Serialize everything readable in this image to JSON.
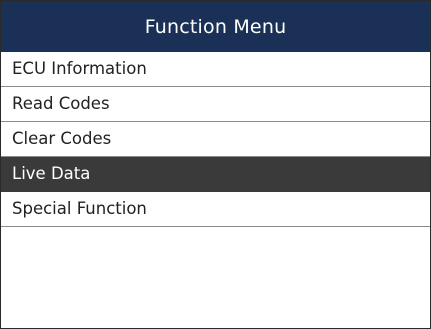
{
  "header": {
    "title": "Function Menu"
  },
  "menu": {
    "selected_index": 3,
    "items": [
      {
        "label": "ECU Information",
        "name": "menu-item-ecu-information"
      },
      {
        "label": "Read Codes",
        "name": "menu-item-read-codes"
      },
      {
        "label": "Clear Codes",
        "name": "menu-item-clear-codes"
      },
      {
        "label": "Live Data",
        "name": "menu-item-live-data"
      },
      {
        "label": "Special Function",
        "name": "menu-item-special-function"
      }
    ]
  },
  "colors": {
    "title_bar": "#1b3056",
    "selected_row": "#3a3a3a",
    "divider": "#8c8c8c"
  }
}
